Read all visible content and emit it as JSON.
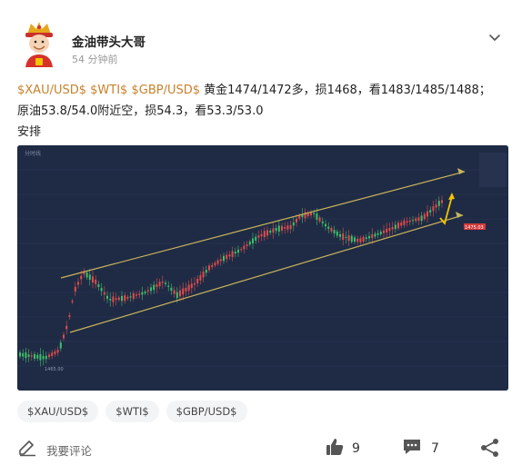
{
  "author": {
    "name": "金油带头大哥",
    "time": "54 分钟前"
  },
  "content": {
    "tags_inline": [
      "$XAU/USD$",
      "$WTI$",
      "$GBP/USD$"
    ],
    "line1_text": " 黄金1474/1472多，损1468，看1483/1485/1488；",
    "line2": "原油53.8/54.0附近空，损54.3，看53.3/53.0",
    "line3": "安排"
  },
  "chart_image": {
    "type": "candlestick",
    "colors": {
      "background": "#1f2b45",
      "up": "#e04c4c",
      "down": "#3fbf6a",
      "channel": "#c9b45a",
      "arrow": "#f5c400"
    },
    "panel_label": "分时线",
    "price_tag": "1475.03",
    "low_tick": "1465.00"
  },
  "tags": [
    "$XAU/USD$",
    "$WTI$",
    "$GBP/USD$"
  ],
  "footer": {
    "comment_placeholder": "我要评论",
    "likes": "9",
    "comments": "7"
  },
  "icons": {
    "more": "chevron-down-icon",
    "comment": "edit-icon",
    "like": "thumbs-up-icon",
    "reply": "comment-icon",
    "share": "share-icon"
  }
}
